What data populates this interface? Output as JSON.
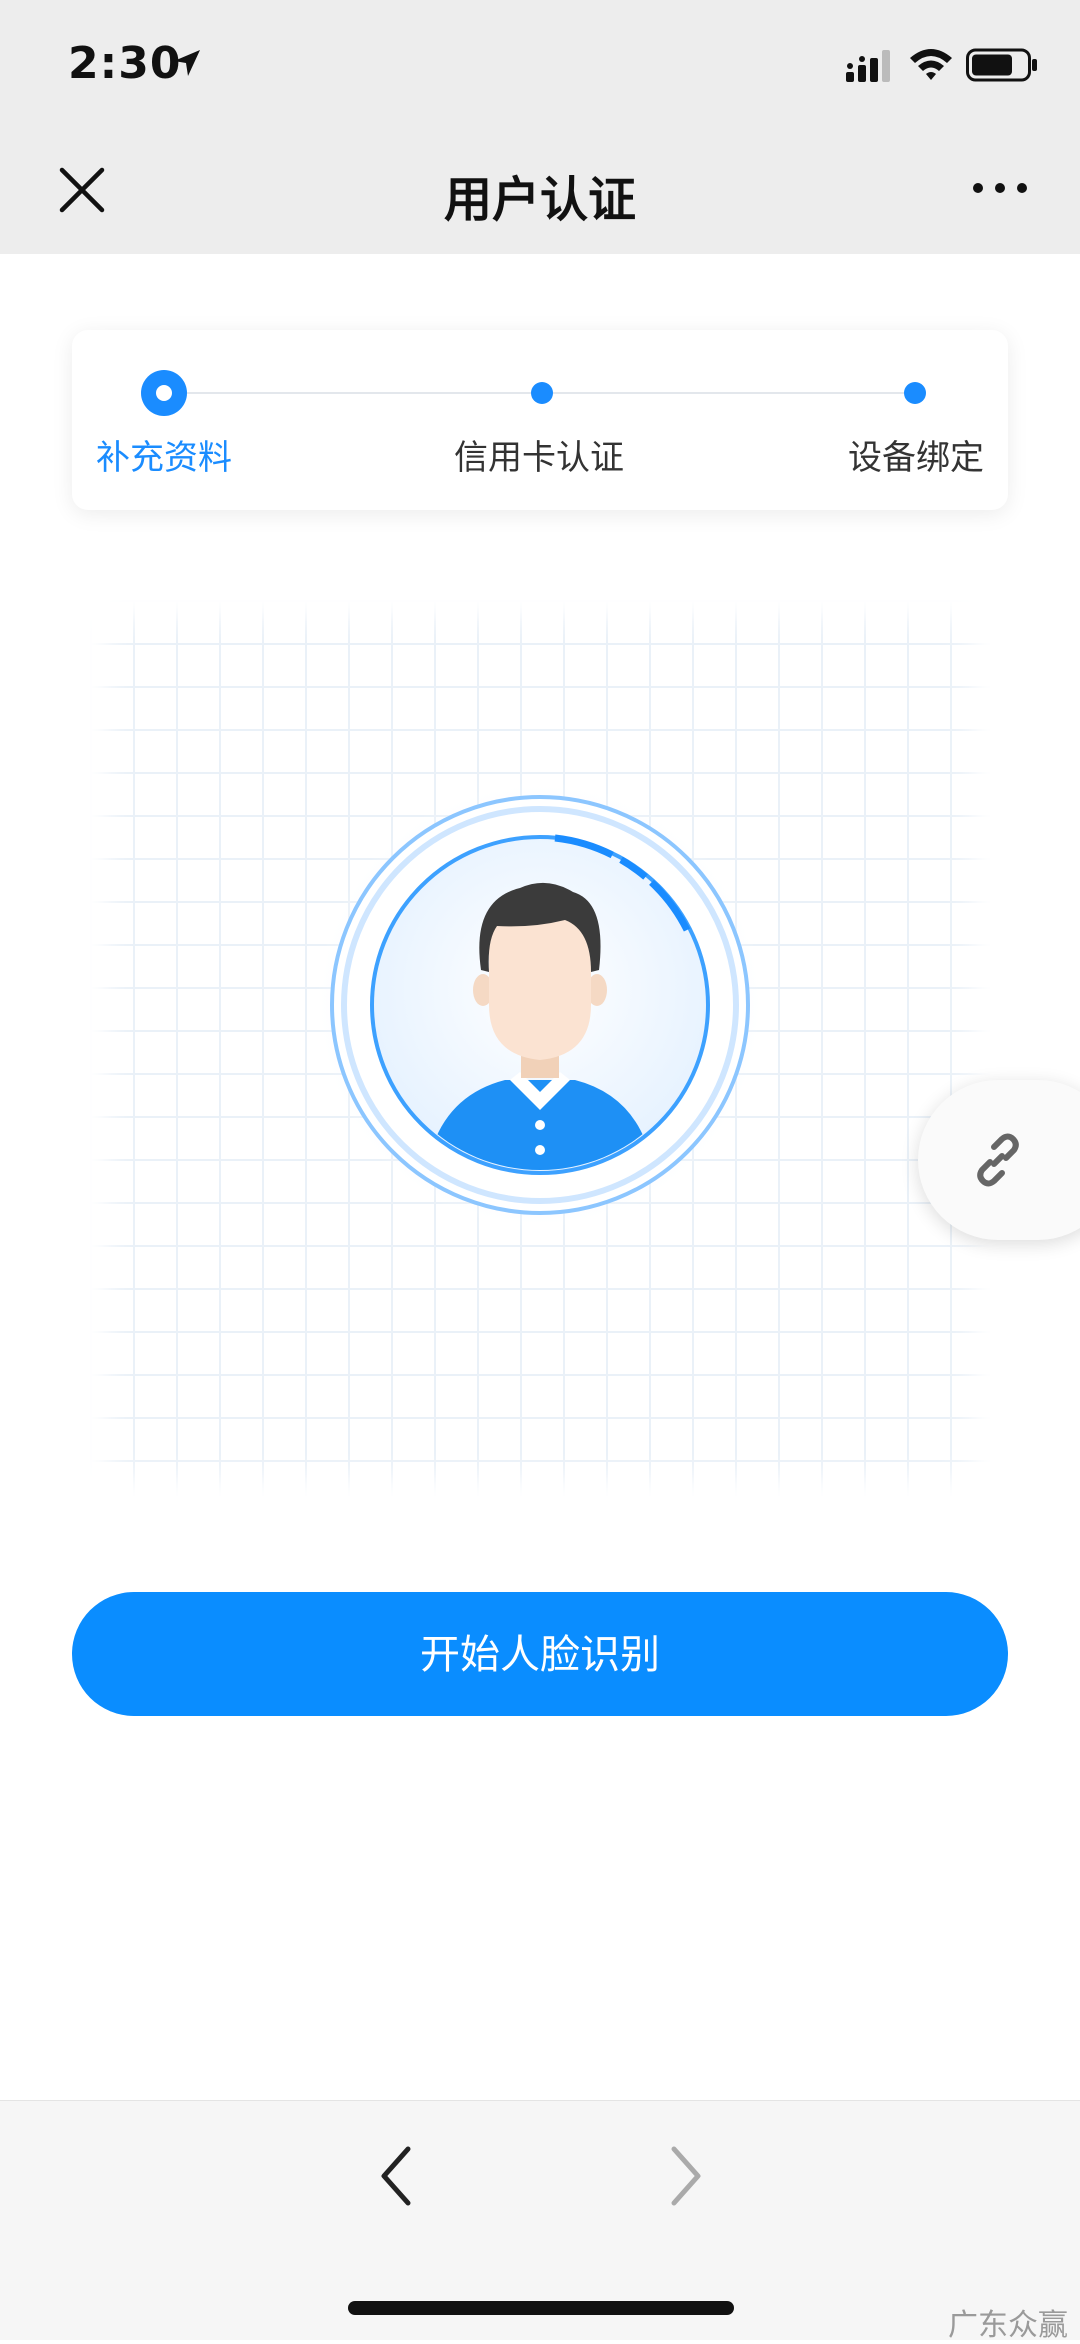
{
  "status_bar": {
    "time": "2:30",
    "icons": [
      "location-arrow-icon",
      "cellular-signal-icon",
      "wifi-icon",
      "battery-icon"
    ]
  },
  "nav": {
    "title": "用户认证",
    "close_icon": "close-icon",
    "more_icon": "more-icon"
  },
  "steps": [
    {
      "label": "补充资料",
      "state": "active"
    },
    {
      "label": "信用卡认证",
      "state": "pending"
    },
    {
      "label": "设备绑定",
      "state": "pending"
    }
  ],
  "face_area": {
    "illustration": "face-avatar-icon"
  },
  "start_button": {
    "label": "开始人脸识别"
  },
  "floating": {
    "icon": "link-icon"
  },
  "toolbar": {
    "back_icon": "chevron-left-icon",
    "forward_icon": "chevron-right-icon"
  },
  "watermark": "广东众赢",
  "colors": {
    "accent": "#0a8dff",
    "nav_bg": "#ededed",
    "grid": "#eaf1f8"
  }
}
